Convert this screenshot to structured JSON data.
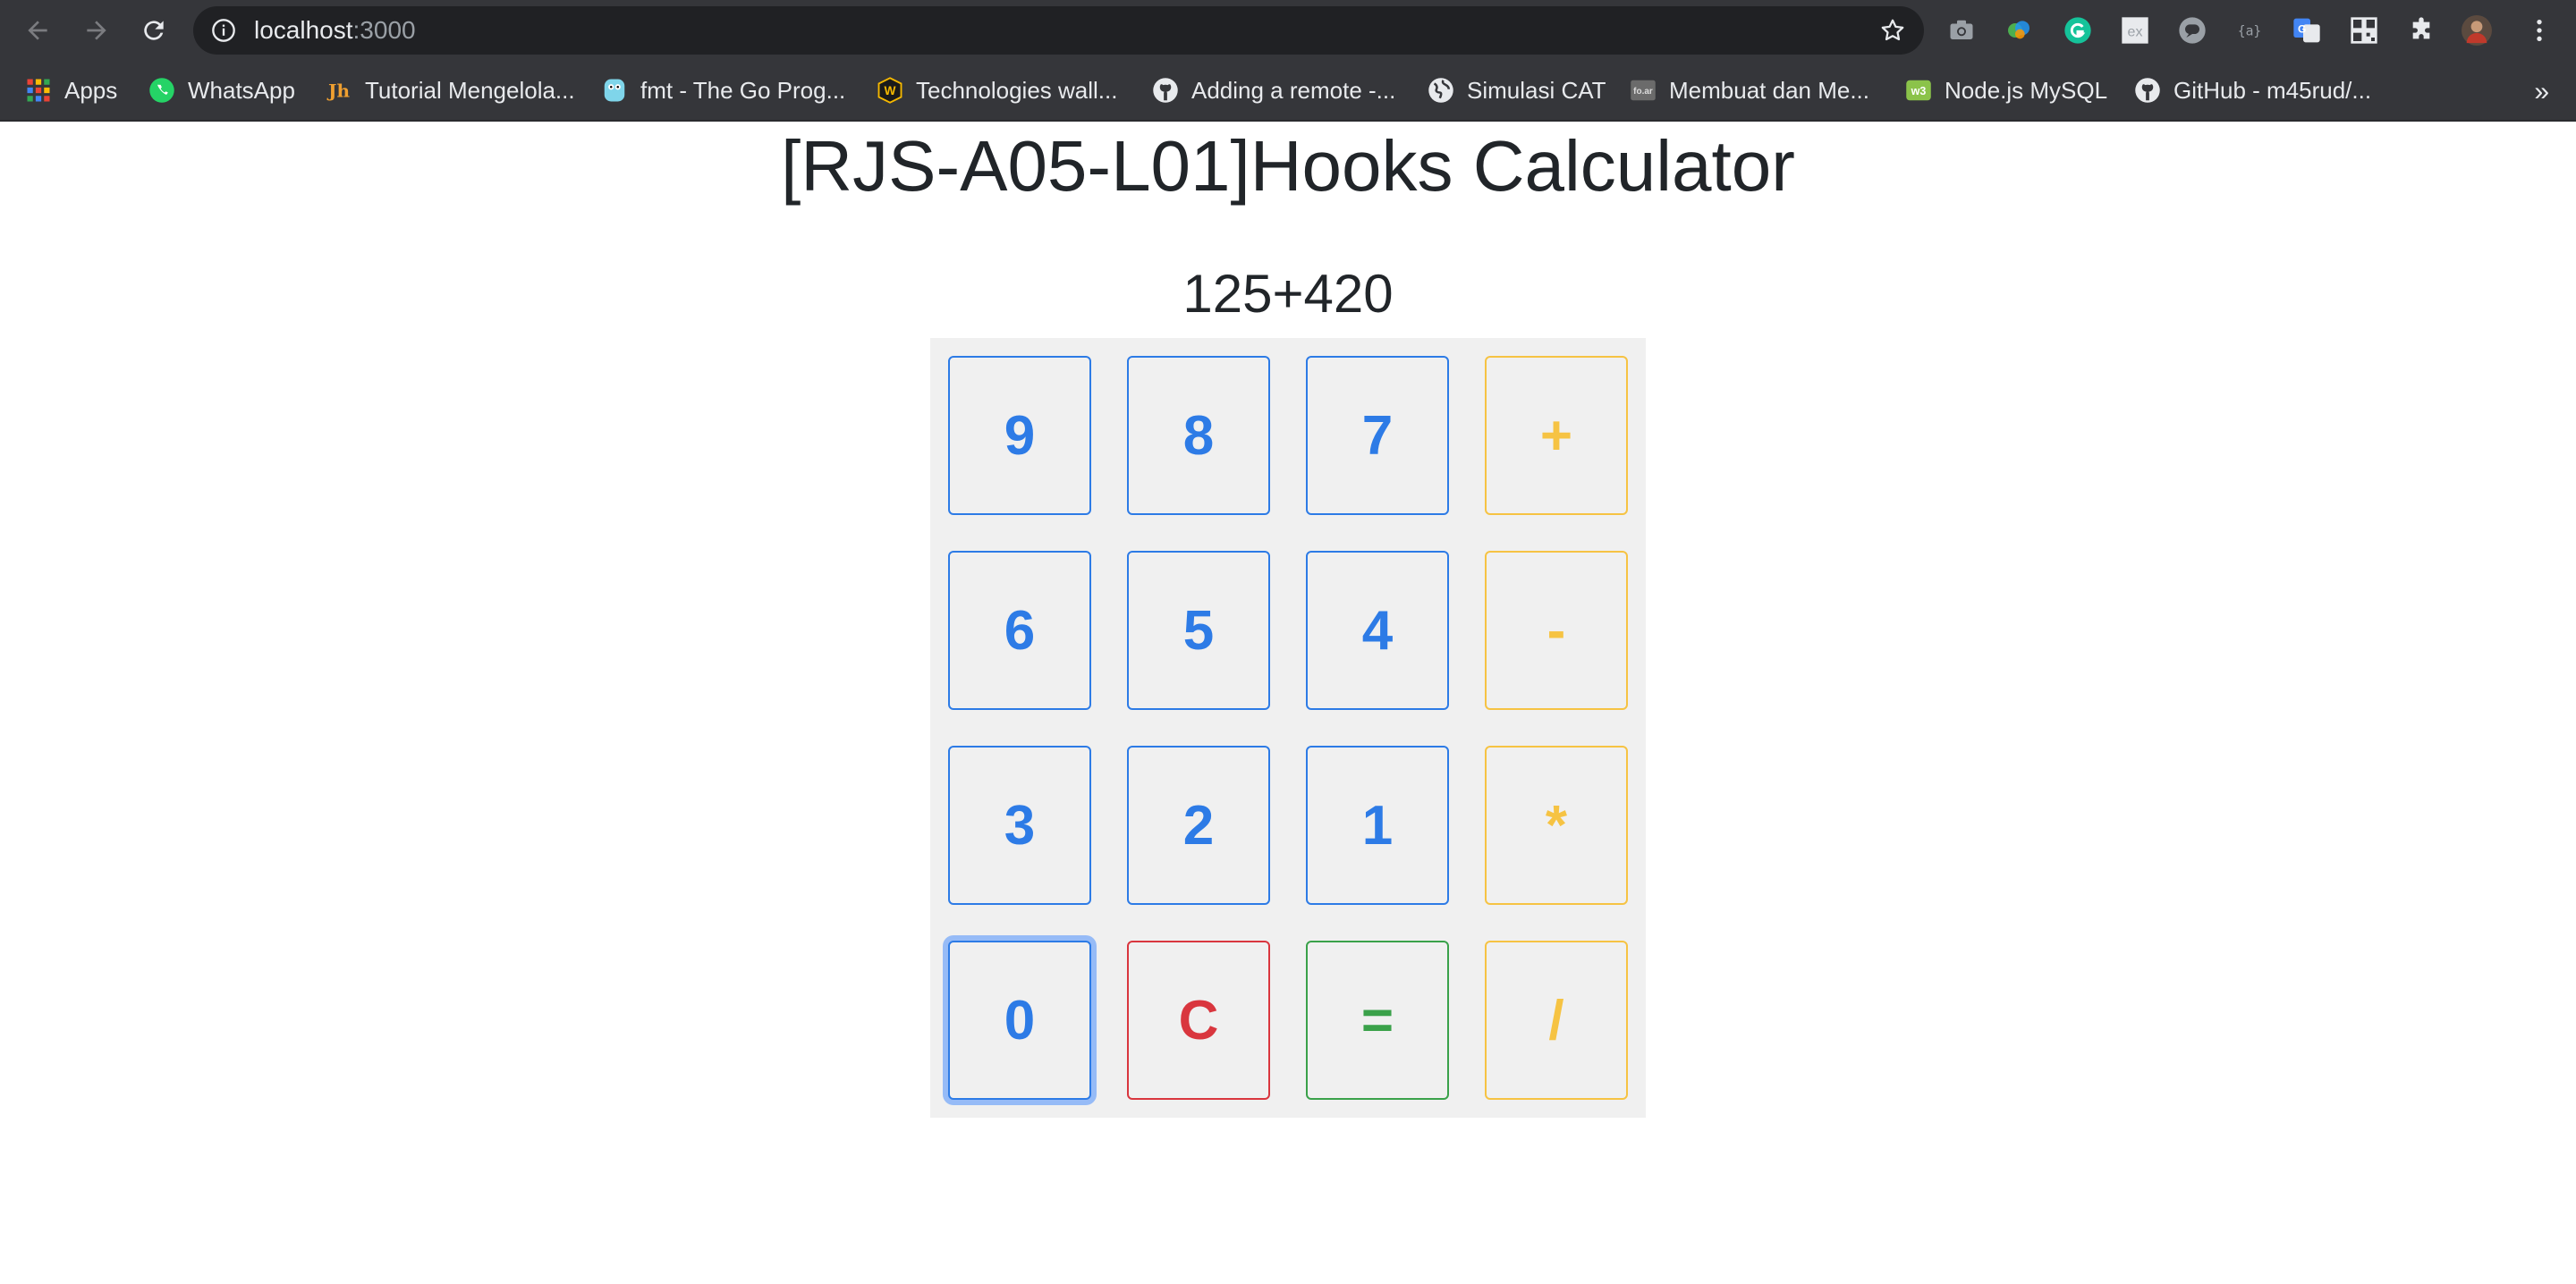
{
  "browser": {
    "url_host": "localhost",
    "url_port": ":3000",
    "bookmarks": [
      {
        "label": "Apps",
        "icon": "apps-grid-icon"
      },
      {
        "label": "WhatsApp",
        "icon": "whatsapp-icon"
      },
      {
        "label": "Tutorial Mengelola...",
        "icon": "jh-logo-icon"
      },
      {
        "label": "fmt - The Go Prog...",
        "icon": "go-gopher-icon"
      },
      {
        "label": "Technologies wall...",
        "icon": "w-badge-icon"
      },
      {
        "label": "Adding a remote -...",
        "icon": "github-icon"
      },
      {
        "label": "Simulasi CAT",
        "icon": "globe-icon"
      },
      {
        "label": "Membuat dan Me...",
        "icon": "site-icon"
      },
      {
        "label": "Node.js MySQL",
        "icon": "w3schools-icon"
      },
      {
        "label": "GitHub - m45rud/...",
        "icon": "github-icon"
      }
    ],
    "more_label": "»"
  },
  "page": {
    "title": "[RJS-A05-L01]Hooks Calculator",
    "display": "125+420"
  },
  "keypad": {
    "keys": [
      "9",
      "8",
      "7",
      "+",
      "6",
      "5",
      "4",
      "-",
      "3",
      "2",
      "1",
      "*",
      "0",
      "C",
      "=",
      "/"
    ]
  },
  "colors": {
    "number": "#2d7be6",
    "operator": "#f6c343",
    "clear": "#d9363e",
    "equals": "#3aa14a"
  }
}
